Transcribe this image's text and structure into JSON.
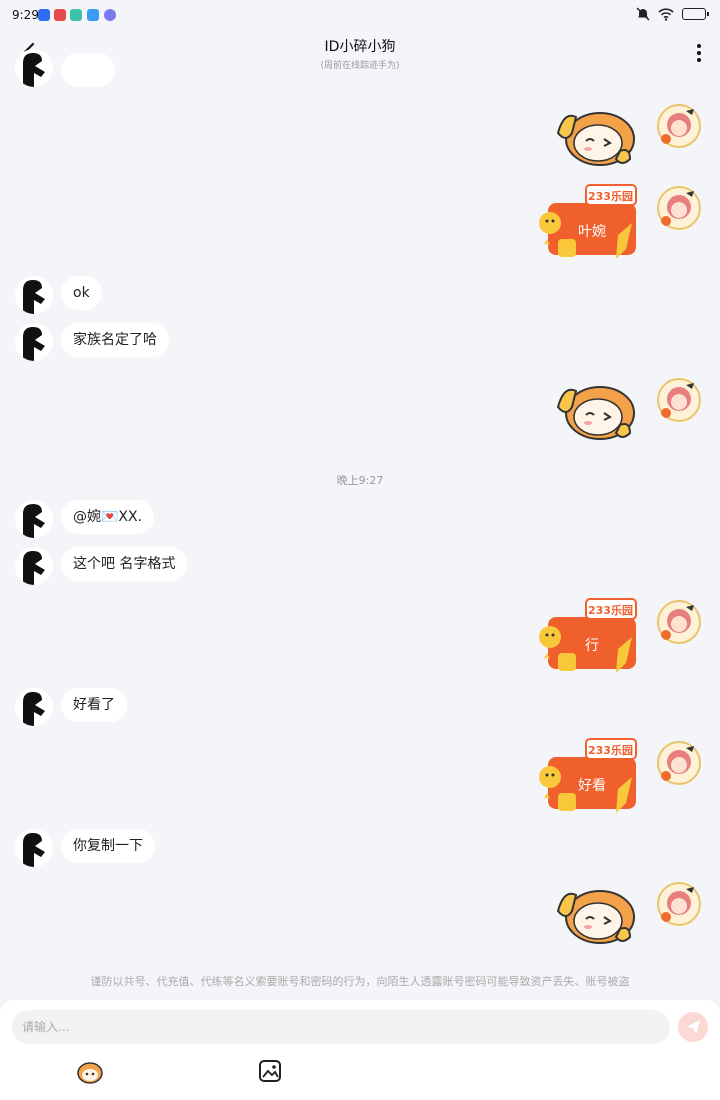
{
  "status_bar": {
    "time": "9:29"
  },
  "header": {
    "title": "ID小碎小狗",
    "subtitle": "(周前在线踪迹手为)"
  },
  "messages": [
    {
      "side": "right",
      "type": "sticker-mascot"
    },
    {
      "side": "right",
      "type": "sticker-233",
      "text": "叶婉"
    },
    {
      "side": "left",
      "type": "text",
      "text": "ok"
    },
    {
      "side": "left",
      "type": "text",
      "text": "家族名定了哈"
    },
    {
      "side": "right",
      "type": "sticker-mascot"
    },
    {
      "type": "timestamp",
      "text": "晚上9:27"
    },
    {
      "side": "left",
      "type": "text",
      "text": "@婉💌XX."
    },
    {
      "side": "left",
      "type": "text",
      "text": "这个吧 名字格式"
    },
    {
      "side": "right",
      "type": "sticker-233",
      "text": "行"
    },
    {
      "side": "left",
      "type": "text",
      "text": "好看了"
    },
    {
      "side": "right",
      "type": "sticker-233",
      "text": "好看"
    },
    {
      "side": "left",
      "type": "text",
      "text": "你复制一下"
    },
    {
      "side": "right",
      "type": "sticker-mascot"
    }
  ],
  "sticker_brand": "233乐园",
  "warning": "谨防以共号、代充值、代练等名义索要账号和密码的行为，向陌生人透露账号密码可能导致资产丢失、账号被盗",
  "input": {
    "placeholder": "请输入..."
  },
  "toolbar": {
    "emoji_icon": "mascot-emoji-icon",
    "image_icon": "image-icon"
  },
  "colors": {
    "background": "#f4f5f9",
    "accent": "#f0602c",
    "send_button": "#fbd9d2"
  }
}
